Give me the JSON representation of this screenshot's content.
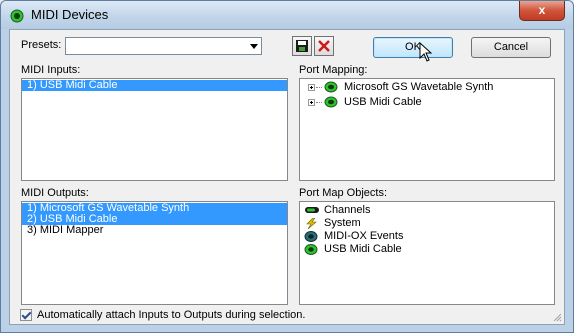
{
  "window": {
    "title": "MIDI Devices",
    "close_glyph": "x"
  },
  "toolbar": {
    "presets_label": "Presets:",
    "presets_value": "",
    "save_icon": "floppy-disk-icon",
    "delete_icon": "red-x-delete-icon",
    "ok_label": "OK",
    "cancel_label": "Cancel"
  },
  "midi_inputs": {
    "label": "MIDI Inputs:",
    "items": [
      {
        "text": "1)  USB Midi Cable",
        "selected": true
      }
    ]
  },
  "port_mapping": {
    "label": "Port Mapping:",
    "items": [
      {
        "text": "Microsoft GS Wavetable Synth",
        "icon": "midi-port-icon"
      },
      {
        "text": "USB Midi Cable",
        "icon": "midi-port-icon"
      }
    ]
  },
  "midi_outputs": {
    "label": "MIDI Outputs:",
    "items": [
      {
        "text": "1)  Microsoft GS Wavetable Synth",
        "selected": true
      },
      {
        "text": "2)  USB Midi Cable",
        "selected": true
      },
      {
        "text": "3)  MIDI Mapper",
        "selected": false
      }
    ]
  },
  "port_map_objects": {
    "label": "Port Map Objects:",
    "items": [
      {
        "text": "Channels",
        "icon": "channels-icon"
      },
      {
        "text": "System",
        "icon": "lightning-icon"
      },
      {
        "text": "MIDI-OX Events",
        "icon": "midi-ox-events-icon"
      },
      {
        "text": "USB Midi Cable",
        "icon": "midi-port-icon"
      }
    ]
  },
  "auto_attach": {
    "checked": true,
    "label": "Automatically attach Inputs to Outputs during selection."
  },
  "colors": {
    "selection": "#3399ff",
    "port_green": "#2fc12f",
    "title_bar": "#c2d6ea"
  }
}
